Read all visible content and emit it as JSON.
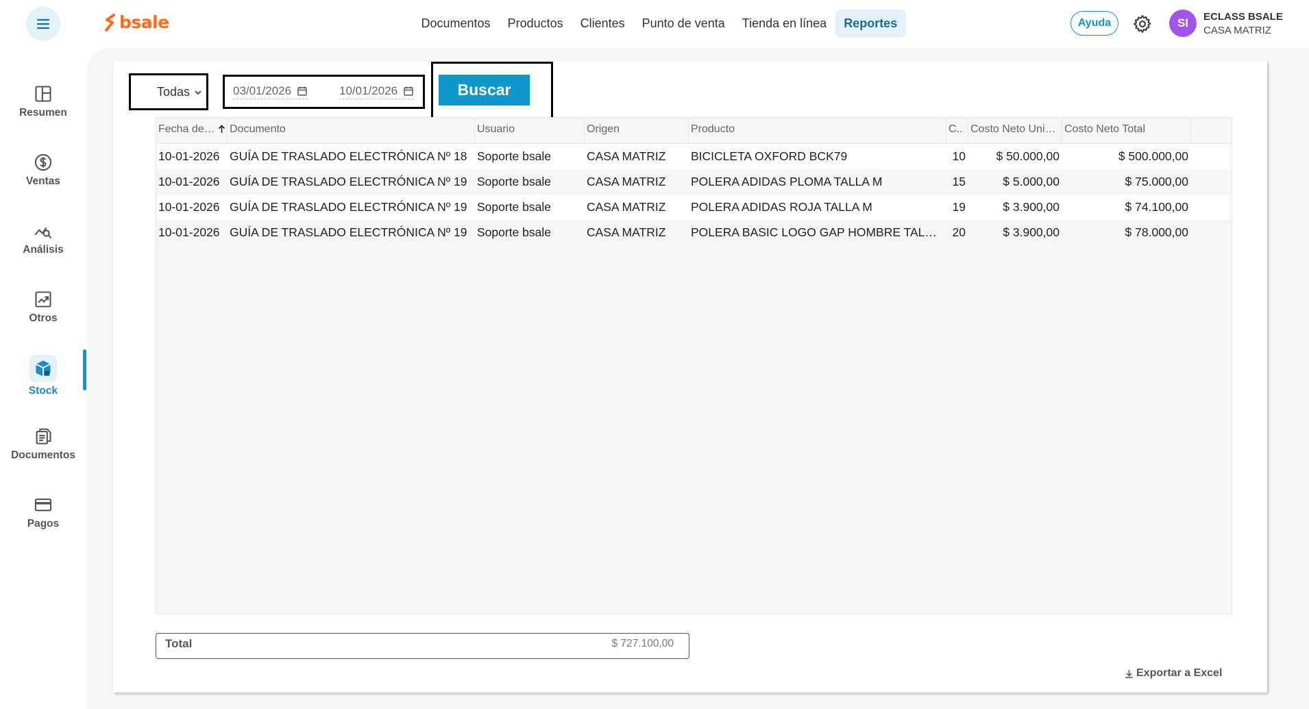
{
  "app": {
    "logo_text": "bsale",
    "brand_color": "#ff6b1a",
    "accent_color": "#0e98c9"
  },
  "header": {
    "nav": [
      {
        "label": "Documentos",
        "active": false
      },
      {
        "label": "Productos",
        "active": false
      },
      {
        "label": "Clientes",
        "active": false
      },
      {
        "label": "Punto de venta",
        "active": false
      },
      {
        "label": "Tienda en línea",
        "active": false
      },
      {
        "label": "Reportes",
        "active": true
      }
    ],
    "help_label": "Ayuda",
    "avatar_initials": "SI",
    "user_name": "ECLASS BSALE",
    "branch": "CASA MATRIZ"
  },
  "sidebar": {
    "items": [
      {
        "label": "Resumen",
        "icon": "layout-icon",
        "active": false
      },
      {
        "label": "Ventas",
        "icon": "dollar-icon",
        "active": false
      },
      {
        "label": "Análisis",
        "icon": "chart-search-icon",
        "active": false
      },
      {
        "label": "Otros",
        "icon": "trend-icon",
        "active": false
      },
      {
        "label": "Stock",
        "icon": "box-icon",
        "active": true
      },
      {
        "label": "Documentos",
        "icon": "document-icon",
        "active": false
      },
      {
        "label": "Pagos",
        "icon": "card-icon",
        "active": false
      }
    ]
  },
  "filters": {
    "type_selected": "Todas",
    "date_from": "03/01/2026",
    "date_to": "10/01/2026",
    "search_label": "Buscar"
  },
  "table": {
    "columns": [
      "Fecha de…",
      "Documento",
      "Usuario",
      "Origen",
      "Producto",
      "C..",
      "Costo Neto Uni…",
      "Costo Neto Total"
    ],
    "rows": [
      [
        "10-01-2026",
        "GUÍA DE TRASLADO ELECTRÓNICA Nº 18",
        "Soporte bsale",
        "CASA MATRIZ",
        "BICICLETA OXFORD BCK79",
        "10",
        "$ 50.000,00",
        "$ 500.000,00"
      ],
      [
        "10-01-2026",
        "GUÍA DE TRASLADO ELECTRÓNICA Nº 19",
        "Soporte bsale",
        "CASA MATRIZ",
        "POLERA ADIDAS PLOMA TALLA M",
        "15",
        "$ 5.000,00",
        "$ 75.000,00"
      ],
      [
        "10-01-2026",
        "GUÍA DE TRASLADO ELECTRÓNICA Nº 19",
        "Soporte bsale",
        "CASA MATRIZ",
        "POLERA ADIDAS ROJA TALLA M",
        "19",
        "$ 3.900,00",
        "$ 74.100,00"
      ],
      [
        "10-01-2026",
        "GUÍA DE TRASLADO ELECTRÓNICA Nº 19",
        "Soporte bsale",
        "CASA MATRIZ",
        "POLERA BASIC LOGO GAP HOMBRE TAL…",
        "20",
        "$ 3.900,00",
        "$ 78.000,00"
      ]
    ]
  },
  "footer": {
    "total_label": "Total",
    "total_value": "$ 727.100,00",
    "export_label": "Exportar a Excel"
  }
}
